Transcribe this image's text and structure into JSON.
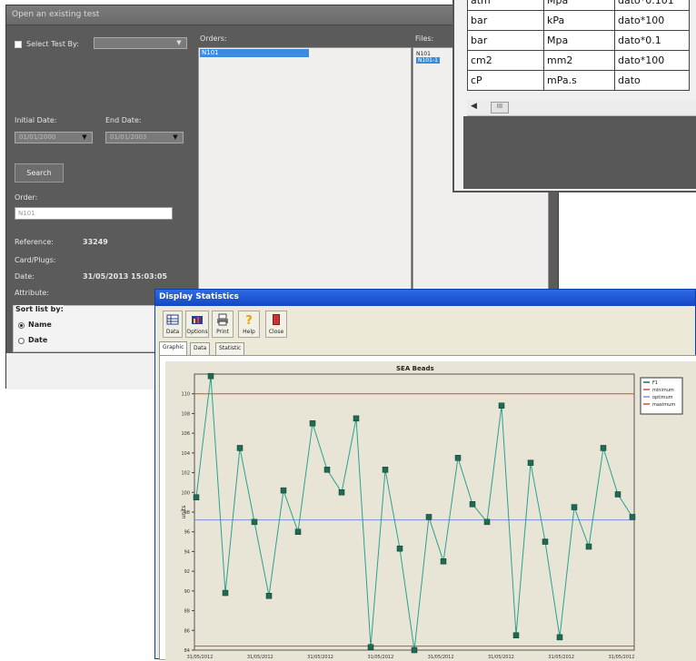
{
  "open_window": {
    "title": "Open an existing test",
    "select_test_label": "Select Test By:",
    "orders_header": "Orders:",
    "files_header": "Files:",
    "initial_date_label": "Initial Date:",
    "end_date_label": "End Date:",
    "initial_date_value": "01/01/2000",
    "end_date_value": "01/01/2003",
    "search_label": "Search",
    "order_label": "Order:",
    "order_value": "N101",
    "reference_label": "Reference:",
    "reference_value": "33249",
    "card_plugs_label": "Card/Plugs:",
    "date_label": "Date:",
    "date_value": "31/05/2013 15:03:05",
    "attribute_label": "Attribute:",
    "orders_selected": "N101",
    "files": [
      "N101",
      "N101-1"
    ],
    "sort_by_label": "Sort list by:",
    "sort_options": [
      {
        "label": "Name",
        "selected": true
      },
      {
        "label": "Date",
        "selected": false
      }
    ]
  },
  "units_table": {
    "rows": [
      {
        "from": "atm",
        "to": "Mpa",
        "formula": "dato*0.101"
      },
      {
        "from": "bar",
        "to": "kPa",
        "formula": "dato*100"
      },
      {
        "from": "bar",
        "to": "Mpa",
        "formula": "dato*0.1"
      },
      {
        "from": "cm2",
        "to": "mm2",
        "formula": "dato*100"
      },
      {
        "from": "cP",
        "to": "mPa.s",
        "formula": "dato"
      }
    ],
    "scroll_left": "◀",
    "scroll_thumb": "III"
  },
  "stats_window": {
    "title": "Display Statistics",
    "toolbar": [
      {
        "label": "Data",
        "icon": "table-icon"
      },
      {
        "label": "Options",
        "icon": "chart-options-icon"
      },
      {
        "label": "Print",
        "icon": "printer-icon"
      },
      {
        "label": "Help",
        "icon": "help-icon"
      },
      {
        "label": "Close",
        "icon": "close-door-icon"
      }
    ],
    "tabs": [
      "Graphic",
      "Data",
      "Statistic"
    ],
    "active_tab": 0
  },
  "colors": {
    "series": "#2aa08e",
    "marker": "#1e6a53",
    "limit_line": "#d34a40",
    "optimum_line": "#7b8fd8",
    "window_title": "#1547c4"
  },
  "chart_data": {
    "type": "line",
    "title": "SEA Beads",
    "ylabel": "units",
    "ylim": [
      84,
      112
    ],
    "yticks": [
      84,
      86,
      88,
      90,
      92,
      94,
      96,
      98,
      100,
      102,
      104,
      106,
      108,
      110
    ],
    "x_tick_labels": [
      "31/05/2012",
      "31/05/2012",
      "31/05/2012",
      "31/05/2012",
      "31/05/2012",
      "31/05/2012",
      "31/05/2012",
      "31/05/2012"
    ],
    "legend": [
      "F1",
      "minimum",
      "optimum",
      "maximum"
    ],
    "maximum": 110,
    "optimum": 97.2,
    "minimum": 84.4,
    "series": [
      {
        "name": "F1",
        "values": [
          99.5,
          111.8,
          89.8,
          104.5,
          97,
          89.5,
          100.2,
          96,
          107,
          102.3,
          100,
          107.5,
          84.3,
          102.3,
          94.3,
          84,
          97.5,
          93,
          103.5,
          98.8,
          97,
          108.8,
          85.5,
          103,
          95,
          85.3,
          98.5,
          94.5,
          104.5,
          99.8,
          97.5
        ]
      }
    ]
  }
}
